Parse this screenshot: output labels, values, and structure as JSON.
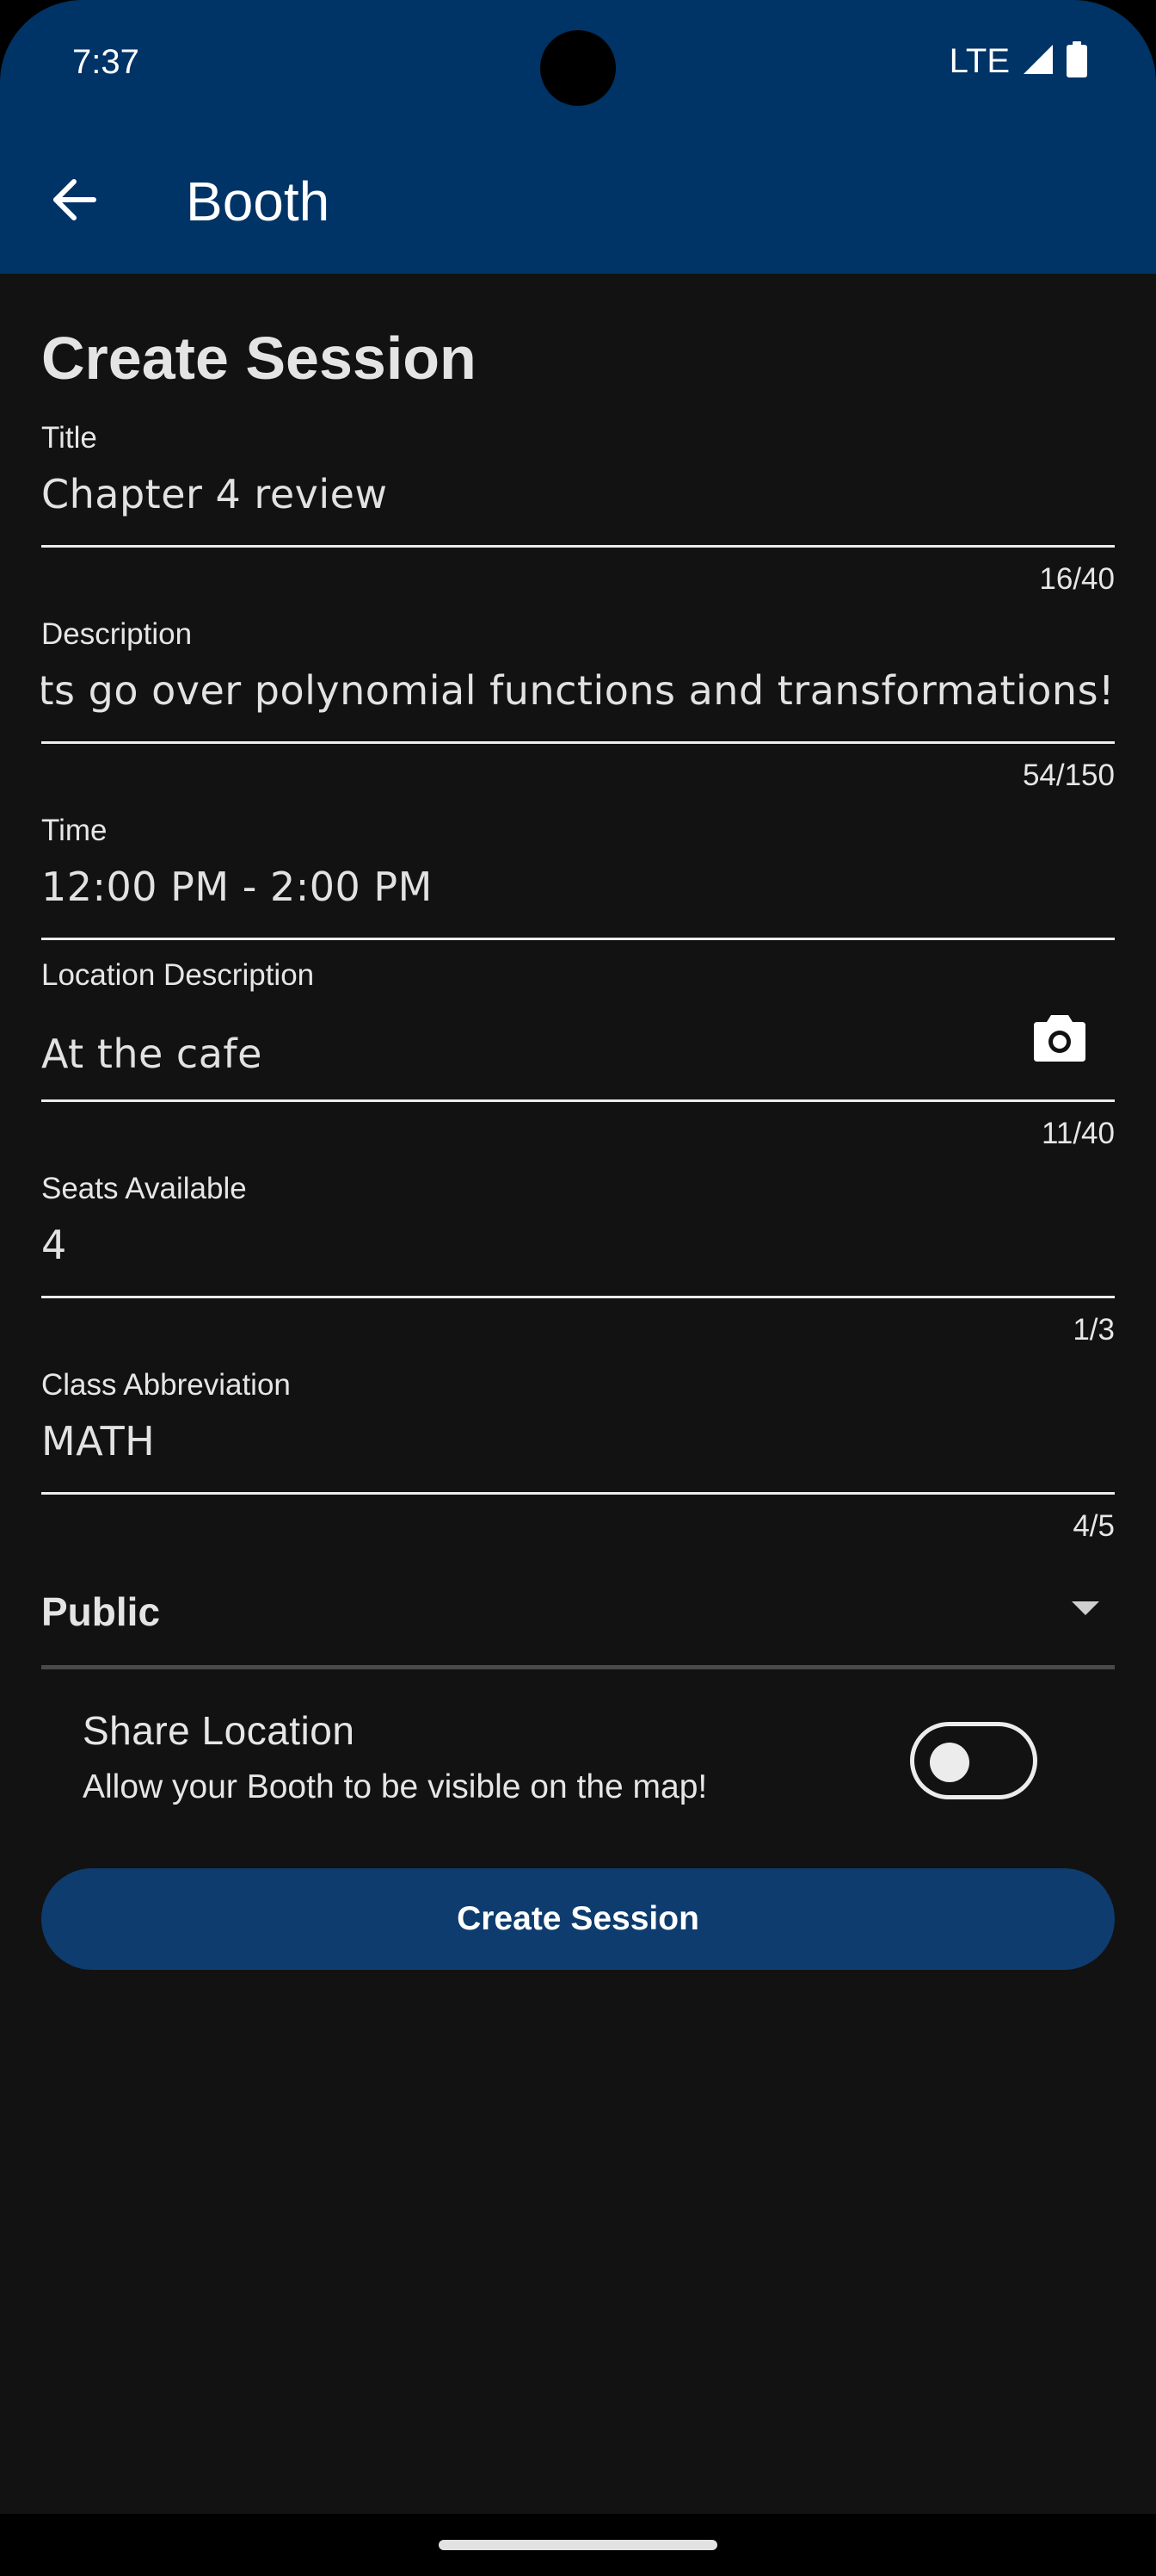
{
  "status_bar": {
    "time": "7:37",
    "network": "LTE",
    "signal_icon": "cell-signal-icon",
    "battery_icon": "battery-icon"
  },
  "app_bar": {
    "back_icon": "arrow-back-icon",
    "title": "Booth",
    "background_color": "#003366"
  },
  "page": {
    "heading": "Create Session"
  },
  "form": {
    "title": {
      "label": "Title",
      "value": "Chapter 4 review",
      "counter": "16/40"
    },
    "description": {
      "label": "Description",
      "value": "Lets go over polynomial functions and transformations!",
      "counter": "54/150"
    },
    "time": {
      "label": "Time",
      "value": "12:00 PM - 2:00 PM"
    },
    "location_description": {
      "label": "Location Description",
      "value": "At the cafe",
      "counter": "11/40",
      "camera_icon": "camera-icon"
    },
    "seats_available": {
      "label": "Seats Available",
      "value": "4",
      "counter": "1/3"
    },
    "class_abbreviation": {
      "label": "Class Abbreviation",
      "value": "MATH",
      "counter": "4/5"
    },
    "visibility": {
      "selected": "Public",
      "arrow_icon": "dropdown-arrow-icon"
    },
    "share_location": {
      "title": "Share Location",
      "subtitle": "Allow your Booth to be visible on the map!",
      "enabled": false
    },
    "submit_label": "Create Session",
    "submit_color": "#0e3c6e"
  }
}
